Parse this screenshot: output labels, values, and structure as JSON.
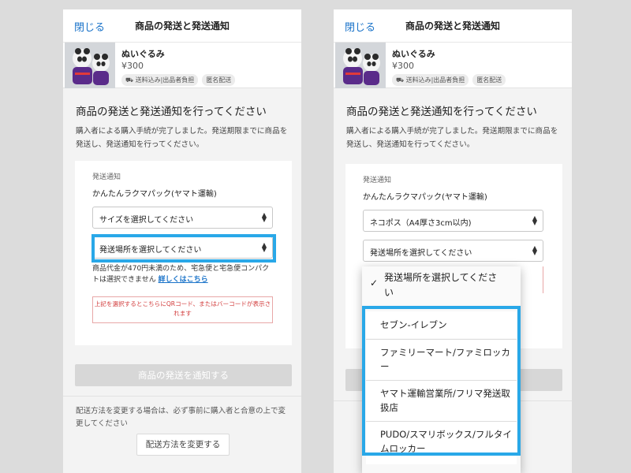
{
  "left": {
    "header": {
      "close": "閉じる",
      "title": "商品の発送と発送通知"
    },
    "product": {
      "name": "ぬいぐるみ",
      "price": "¥300",
      "tag_shipping": "送料込み|出品者負担",
      "tag_anon": "匿名配送"
    },
    "heading": "商品の発送と発送通知を行ってください",
    "description": "購入者による購入手続が完了しました。発送期限までに商品を発送し、発送通知を行ってください。",
    "card": {
      "label": "発送通知",
      "method": "かんたんラクマパック(ヤマト運輸)",
      "size_select": "サイズを選択してください",
      "place_select": "発送場所を選択してください",
      "note": "商品代金が470円未満のため、宅急便と宅急便コンパクトは選択できません",
      "note_link": "詳しくはこちら",
      "warning": "上記を選択するとこちらにQRコード、またはバーコードが表示されます"
    },
    "notify_button": "商品の発送を通知する",
    "footer_note": "配送方法を変更する場合は、必ず事前に購入者と合意の上で変更してください",
    "change_button": "配送方法を変更する"
  },
  "right": {
    "header": {
      "close": "閉じる",
      "title": "商品の発送と発送通知"
    },
    "product": {
      "name": "ぬいぐるみ",
      "price": "¥300",
      "tag_shipping": "送料込み|出品者負担",
      "tag_anon": "匿名配送"
    },
    "heading": "商品の発送と発送通知を行ってください",
    "description": "購入者による購入手続が完了しました。発送期限までに商品を発送し、発送通知を行ってください。",
    "card": {
      "label": "発送通知",
      "method": "かんたんラクマパック(ヤマト運輸)",
      "size_select": "ネコポス（A4厚さ3cm以内)",
      "place_select": "発送場所を選択してください"
    },
    "dropdown": {
      "selected": "発送場所を選択してください",
      "options": [
        "セブン-イレブン",
        "ファミリーマート/ファミロッカー",
        "ヤマト運輸営業所/フリマ発送取扱店",
        "PUDO/スマリボックス/フルタイムロッカー"
      ]
    }
  },
  "colors": {
    "highlight": "#29a8e8",
    "link": "#1a73c9",
    "warning": "#d23b3b"
  }
}
